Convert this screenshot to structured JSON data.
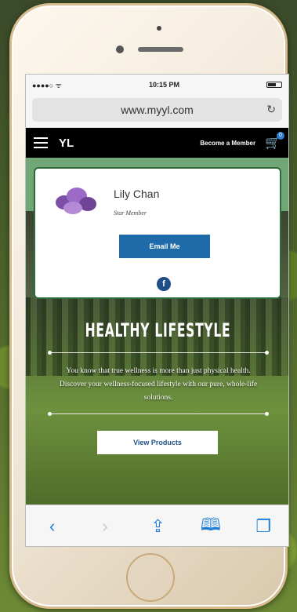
{
  "status_bar": {
    "time": "10:15 PM"
  },
  "browser": {
    "url": "www.myyl.com",
    "reload_icon": "reload-icon"
  },
  "site_nav": {
    "become_member": "Become a Member",
    "cart_count": "0"
  },
  "profile_card": {
    "name": "Lily Chan",
    "rank": "Star Member",
    "email_button": "Email Me",
    "social_icon": "facebook-icon"
  },
  "hero": {
    "headline": "HEALTHY LIFESTYLE",
    "intro": "You know that true wellness is more than just physical health. Discover your wellness-focused lifestyle with our pure, whole-life solutions.",
    "button": "View Products"
  },
  "toolbar": {
    "back_icon": "chevron-left-icon",
    "forward_icon": "chevron-right-icon",
    "share_icon": "share-icon",
    "bookmarks_icon": "book-icon",
    "tabs_icon": "tabs-icon"
  },
  "colors": {
    "button_blue": "#1f6aa8",
    "card_border": "#2d6b3a",
    "ios_blue": "#1f7ed6"
  }
}
